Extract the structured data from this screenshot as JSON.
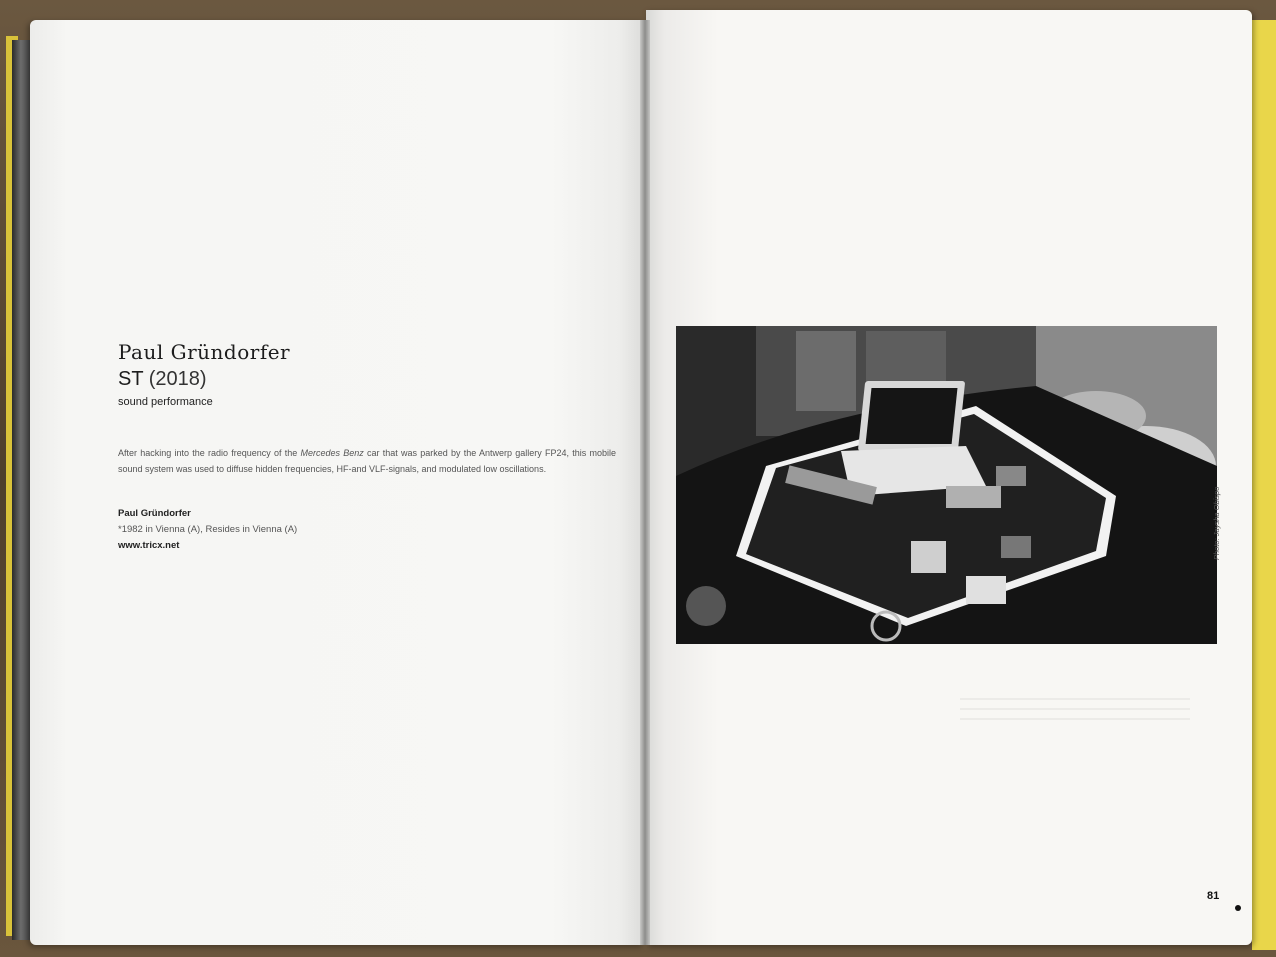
{
  "left_page": {
    "artist_name": "Paul Gründorfer",
    "work_title": "ST",
    "work_year": "(2018)",
    "medium": "sound performance",
    "description_before_italic": "After hacking into the radio frequency of the ",
    "description_italic": "Mercedes Benz",
    "description_after_italic": " car that was parked by the Antwerp gallery FP24, this mobile sound system was used to diffuse hidden frequencies, HF-and VLF-signals, and modulated low oscillations.",
    "bio_name": "Paul Gründorfer",
    "bio_line": "*1982 in Vienna (A), Resides in Vienna (A)",
    "website": "www.tricx.net"
  },
  "right_page": {
    "photo_credit": "Photo: Jaysha Obispo",
    "page_number": "81"
  },
  "colors": {
    "paper": "#f7f6f3",
    "text": "#1d1d1d",
    "accent_yellow": "#e9d64a"
  }
}
